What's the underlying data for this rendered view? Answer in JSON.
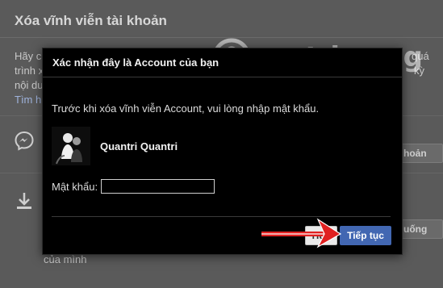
{
  "background": {
    "title": "Xóa vĩnh viễn tài khoản",
    "lines": [
      "Hãy c",
      "trình x",
      "nội du",
      "Tìm h"
    ],
    "right_fragments": [
      "quá",
      "kỳ"
    ],
    "button_1": "hoản",
    "button_2": "uống",
    "bottom_text": "của mình",
    "icons": [
      "messenger-icon",
      "download-icon"
    ]
  },
  "watermark": {
    "text": "uantrimang"
  },
  "modal": {
    "title": "Xác nhận đây là Account của bạn",
    "prompt": "Trước khi xóa vĩnh viễn Account, vui lòng nhập mật khẩu.",
    "user_name": "Quantri Quantri",
    "password_label": "Mật khẩu:",
    "password_value": "",
    "cancel_label": "Hủy",
    "continue_label": "Tiếp tục"
  },
  "colors": {
    "primary_button": "#4267b2",
    "arrow": "#e02020",
    "modal_bg": "#000000"
  }
}
